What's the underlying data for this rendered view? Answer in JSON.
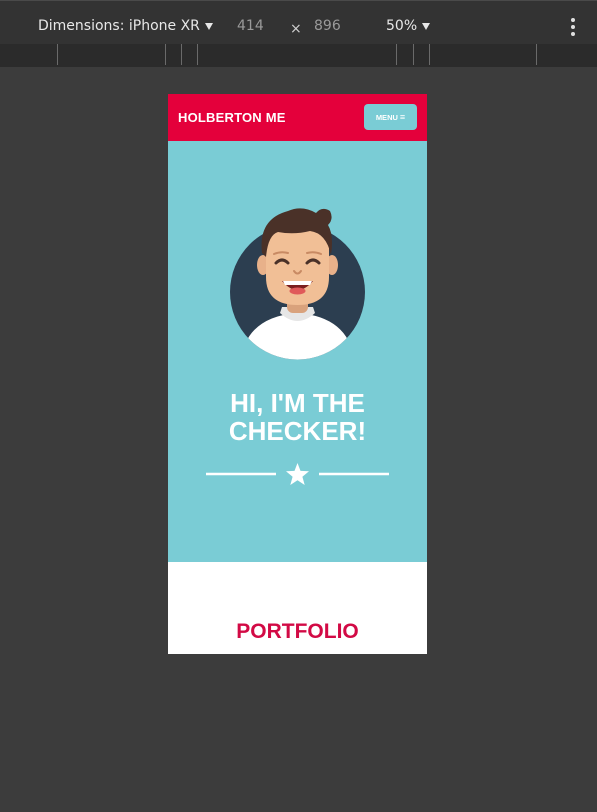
{
  "devtools": {
    "device_label": "Dimensions: iPhone XR",
    "width_value": "414",
    "times_symbol": "×",
    "height_value": "896",
    "zoom_value": "50%"
  },
  "site": {
    "logo": "HOLBERTON ME",
    "menu_label": "MENU",
    "menu_icon": "≡",
    "hero_title": "HI, I'M THE\nCHECKER!",
    "section_title": "PORTFOLIO"
  },
  "colors": {
    "header_bg": "#e4003b",
    "hero_bg": "#7accd5",
    "menu_bg": "#7accd5",
    "portfolio_title": "#d20a45",
    "avatar_circle": "#2c3e50"
  },
  "icons": {
    "device_caret": "caret-down-icon",
    "zoom_caret": "caret-down-icon",
    "more": "kebab-menu-icon",
    "menu": "hamburger-icon",
    "divider_star": "star-icon"
  }
}
